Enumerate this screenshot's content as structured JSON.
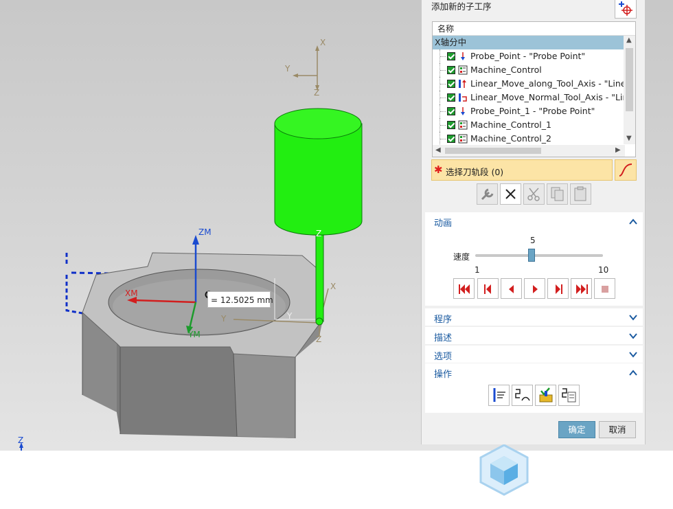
{
  "viewport": {
    "axis_labels": {
      "top_x": "X",
      "top_y": "Y",
      "top_z": "Z",
      "zm": "ZM",
      "xm": "XM",
      "ym": "YM",
      "tool_z": "Z",
      "tool_x": "X",
      "tool_y": "Y",
      "tool_y2": "Y",
      "tool_z2": "Z",
      "corner_z": "Z"
    },
    "measurement": "= 12.5025 mm"
  },
  "panel": {
    "add_subop_label": "添加新的子工序",
    "tree": {
      "header": "名称",
      "group": "X轴分中",
      "items": [
        {
          "label": "Probe_Point - \"Probe Point\"",
          "icon": "probe-point-icon"
        },
        {
          "label": "Machine_Control",
          "icon": "machine-control-icon"
        },
        {
          "label": "Linear_Move_along_Tool_Axis - \"Linear",
          "icon": "linear-move-axis-icon"
        },
        {
          "label": "Linear_Move_Normal_Tool_Axis - \"Line",
          "icon": "linear-move-normal-icon"
        },
        {
          "label": "Probe_Point_1 - \"Probe Point\"",
          "icon": "probe-point-icon"
        },
        {
          "label": "Machine_Control_1",
          "icon": "machine-control-icon"
        },
        {
          "label": "Machine_Control_2",
          "icon": "machine-control-icon"
        }
      ]
    },
    "select_toolpath": "选择刀轨段 (0)",
    "animation": {
      "title": "动画",
      "speed_label": "速度",
      "speed_value": "5",
      "speed_min": "1",
      "speed_max": "10",
      "speed_fraction": 0.44
    },
    "sections": {
      "program": "程序",
      "description": "描述",
      "options": "选项",
      "operation": "操作"
    },
    "buttons": {
      "ok": "确定",
      "cancel": "取消"
    }
  },
  "colors": {
    "accent": "#6aa4c4",
    "tool_green": "#22ee11",
    "header_blue": "#1a5aa0"
  }
}
